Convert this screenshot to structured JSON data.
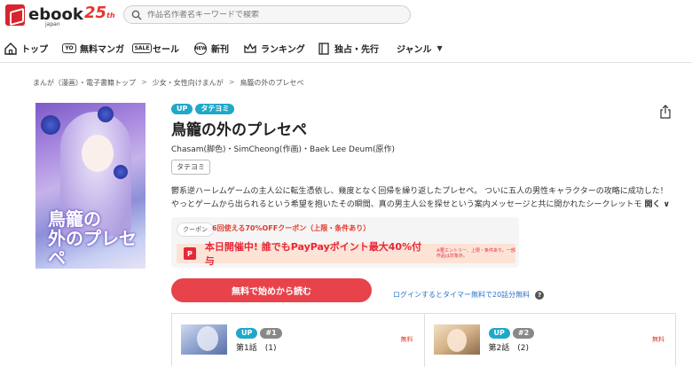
{
  "header": {
    "logo_text": "ebook",
    "logo_sub": "japan",
    "anniversary": "25",
    "anniversary_suffix": "th",
    "search_placeholder": "作品名作者名キーワードで検索"
  },
  "nav": {
    "items": [
      {
        "label": "トップ"
      },
      {
        "label": "無料マンガ"
      },
      {
        "label": "セール"
      },
      {
        "label": "新刊"
      },
      {
        "label": "ランキング"
      },
      {
        "label": "独占・先行"
      },
      {
        "label": "ジャンル"
      }
    ],
    "icon_text": {
      "yo": "YO",
      "sale": "SALE",
      "new": "NEW"
    }
  },
  "breadcrumb": [
    "まんが（漫画）・電子書籍トップ",
    "少女・女性向けまんが",
    "鳥籠の外のプレセペ"
  ],
  "book": {
    "badges": [
      "UP",
      "タテヨミ"
    ],
    "title": "鳥籠の外のプレセペ",
    "authors": "Chasam(脚色)・SimCheong(作画)・Baek Lee Deum(原作)",
    "tag": "タテヨミ",
    "cover_title_line1": "鳥籠の",
    "cover_title_line2": "外のプレセペ",
    "description_line1": "鬱系逆ハーレムゲームの主人公に転生憑依し、幾度となく回帰を繰り返したプレセペ。 ついに五人の男性キャラクターの攻略に成功した！",
    "description_line2": "やっとゲームから出られるという希望を抱いたその瞬間、真の男主人公を探せという案内メッセージと共に開かれたシークレットモ",
    "more_label": "開く",
    "more_icon": "∨"
  },
  "coupon": {
    "label": "クーポン",
    "text": "6回使える70%OFFクーポン（上限・条件あり）",
    "paypay_logo": "P",
    "paypay_text": "本日開催中! 誰でもPayPayポイント最大40%付与",
    "paypay_note": "※要エントリー、上限・条件あり。一部作品は対象外。"
  },
  "actions": {
    "read_button": "無料で始めから読む",
    "login_link": "ログインするとタイマー無料で20話分無料",
    "help_icon": "?"
  },
  "episodes": [
    {
      "badge": "UP",
      "num": "#1",
      "title": "第1話　(1)",
      "price": "無料"
    },
    {
      "badge": "UP",
      "num": "#2",
      "title": "第2話　(2)",
      "price": "無料"
    }
  ],
  "colors": {
    "brand_red": "#e8424b",
    "badge_blue": "#1fa8c9",
    "link_blue": "#2a73c9"
  }
}
